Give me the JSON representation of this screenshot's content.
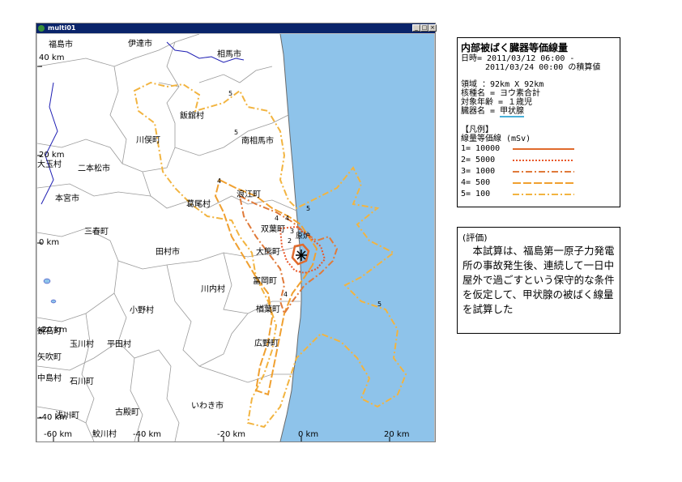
{
  "window": {
    "title": "multi01"
  },
  "map": {
    "place_labels": [
      "福島市",
      "伊達市",
      "相馬市",
      "飯舘村",
      "南相馬市",
      "川俣町",
      "二本松市",
      "大玉村",
      "本宮市",
      "葛尾村",
      "浪江町",
      "三春町",
      "双葉町",
      "大熊町",
      "田村市",
      "富岡町",
      "川内村",
      "楢葉町",
      "小野村",
      "広野町",
      "平田村",
      "玉川村",
      "矢吹町",
      "鏡石町",
      "中島村",
      "石川町",
      "浅川町",
      "古殿町",
      "いわき市",
      "鮫川村"
    ],
    "axis_labels": [
      "40 km",
      "20 km",
      "0 km",
      "-20 km",
      "-40 km",
      "-60 km",
      "-40 km",
      "-20 km",
      "0 km",
      "20 km"
    ],
    "plant_label": "原炉",
    "contour_level_labels": [
      "5",
      "5",
      "5",
      "4",
      "4",
      "4",
      "4",
      "3",
      "2",
      "5"
    ],
    "colors": {
      "sea": "#8ec3ea",
      "land_line": "#9a9a9a",
      "river": "#1f1fb4"
    }
  },
  "legend": {
    "title": "内部被ばく臓器等価線量",
    "date_line1": "日時= 2011/03/12 06:00 -",
    "date_line2": "2011/03/24 00:00 の積算値",
    "region": "領域       ：92km X 92km",
    "nuclide": "核種名   = ヨウ素合計",
    "age": "対象年齢  = １歳児",
    "organ_label": "臓器名   = ",
    "organ_value": "甲状腺",
    "heading": "【凡例】",
    "unit_line": "線量等価線 (mSv)",
    "items": [
      {
        "label": "1= 10000",
        "color": "#e06a2c"
      },
      {
        "label": "2= 5000",
        "color": "#e8582a"
      },
      {
        "label": "3= 1000",
        "color": "#e07a3a"
      },
      {
        "label": "4= 500",
        "color": "#f0a030"
      },
      {
        "label": "5= 100",
        "color": "#f2b440"
      }
    ]
  },
  "evaluation": {
    "heading": "(評価)",
    "body": "本試算は、福島第一原子力発電所の事故発生後、連続して一日中屋外で過ごすという保守的な条件を仮定して、甲状腺の被ばく線量を試算した"
  }
}
